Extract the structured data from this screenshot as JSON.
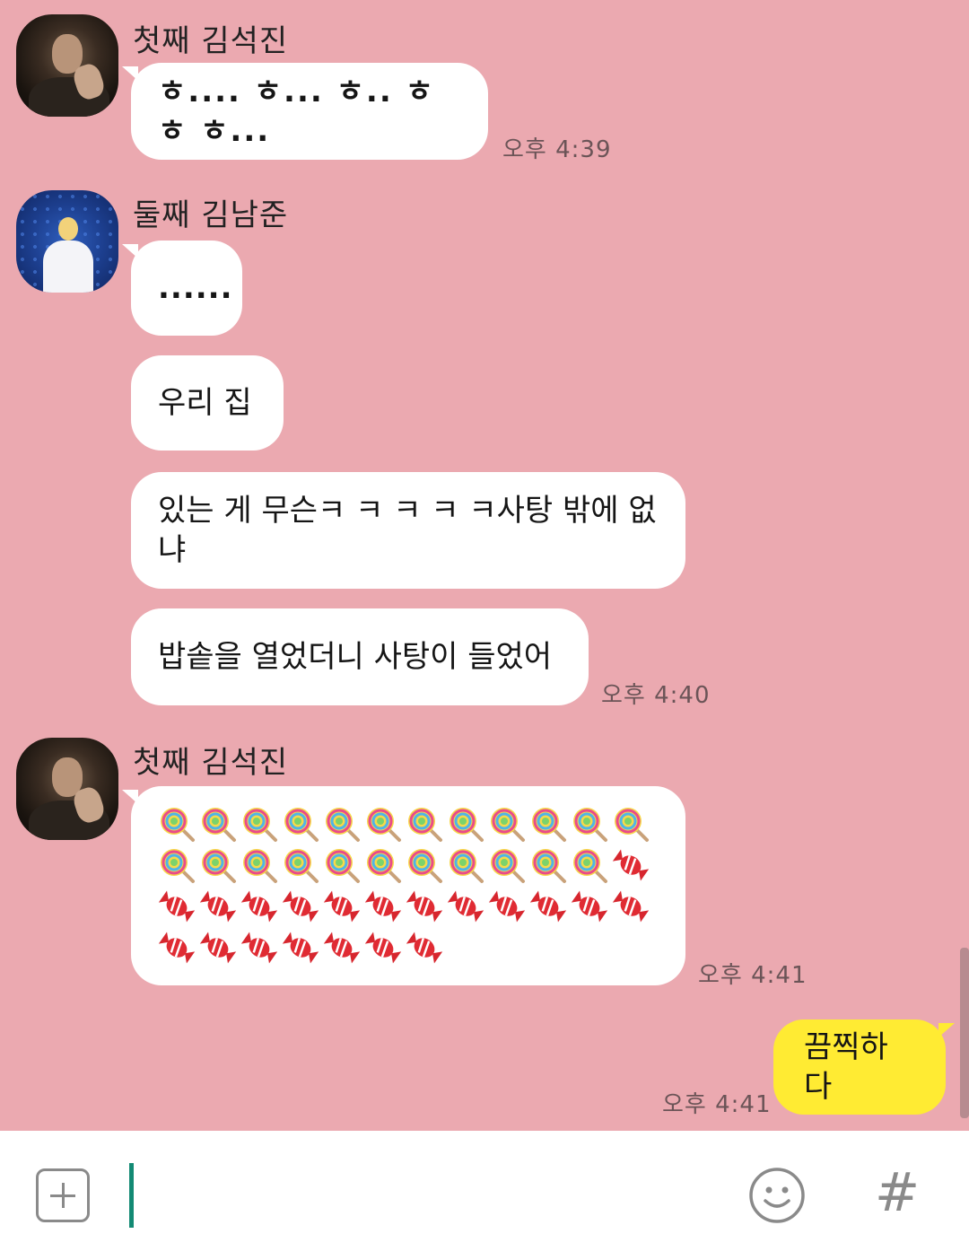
{
  "chat": {
    "groups": [
      {
        "sender": "첫째 김석진",
        "avatar": "jin-avatar",
        "messages": [
          "ㅎ.... ㅎ... ㅎ.. ㅎ ㅎ ㅎ..."
        ],
        "time": "오후 4:39"
      },
      {
        "sender": "둘째 김남준",
        "avatar": "namjoon-avatar",
        "messages": [
          "......",
          "우리 집",
          "있는 게 무슨ㅋ ㅋ ㅋ ㅋ ㅋ사탕 밖에 없냐",
          "밥솥을 열었더니 사탕이 들었어"
        ],
        "time": "오후 4:40"
      },
      {
        "sender": "첫째 김석진",
        "avatar": "jin-avatar",
        "messages": [
          "🍭🍭🍭🍭🍭🍭🍭🍭🍭🍭🍭🍭🍭🍭🍭🍭🍭🍭🍭🍭🍭🍭🍭🍬🍬🍬🍬🍬🍬🍬🍬🍬🍬🍬🍬🍬🍬🍬🍬🍬🍬🍬🍬🍬"
        ],
        "emoji_counts": {
          "lollipop": 23,
          "candy": 20
        },
        "time": "오후 4:41"
      }
    ],
    "my_message": {
      "text": "끔찍하다",
      "time": "오후 4:41"
    }
  },
  "input_bar": {
    "value": "",
    "placeholder": "",
    "icons": [
      "plus-icon",
      "emoticon-icon",
      "hashtag-icon"
    ],
    "hash_glyph": "#"
  },
  "colors": {
    "background": "#eba9b0",
    "incoming_bubble": "#ffffff",
    "outgoing_bubble": "#ffeb33",
    "caret": "#138a74"
  }
}
